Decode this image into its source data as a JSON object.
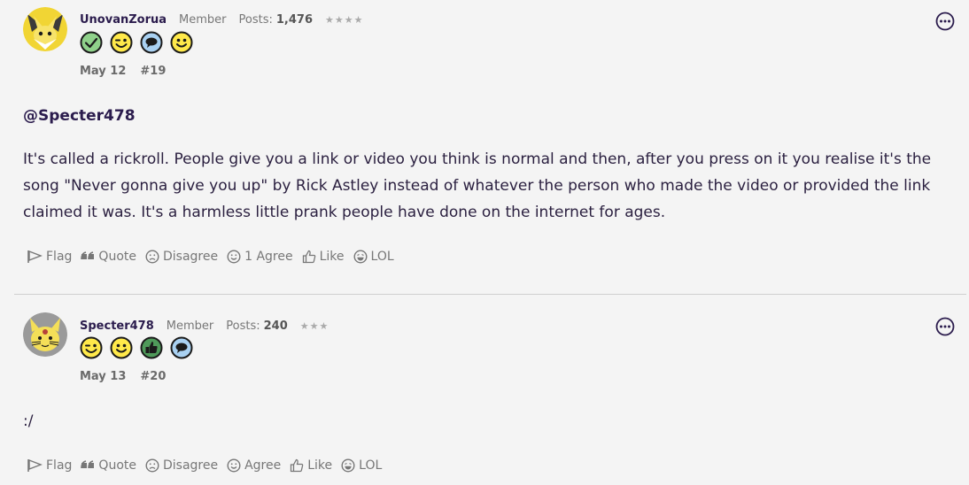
{
  "posts": [
    {
      "username": "UnovanZorua",
      "role": "Member",
      "posts_label": "Posts:",
      "posts_count": "1,476",
      "stars": "★★★★",
      "date": "May 12",
      "number": "#19",
      "badges": [
        "check-badge-icon",
        "wink-badge-icon",
        "speech-badge-icon",
        "smile-badge-icon"
      ],
      "mention": "@Specter478",
      "body_lines": [
        "It's called a rickroll. People give you a link or video you think is normal and then, after you press on it you realise it's the",
        "song \"Never gonna give you up\" by Rick Astley instead of whatever the person who made the video or provided the link",
        "claimed it was. It's a harmless little prank people have done on the internet for ages."
      ],
      "actions": {
        "flag": "Flag",
        "quote": "Quote",
        "disagree": "Disagree",
        "agree": "1 Agree",
        "like": "Like",
        "lol": "LOL"
      }
    },
    {
      "username": "Specter478",
      "role": "Member",
      "posts_label": "Posts:",
      "posts_count": "240",
      "stars": "★★★",
      "date": "May 13",
      "number": "#20",
      "badges": [
        "wink-badge-icon",
        "smile-badge-icon",
        "thumbs-up-badge-icon",
        "speech-badge-icon"
      ],
      "body_lines": [
        ":/"
      ],
      "actions": {
        "flag": "Flag",
        "quote": "Quote",
        "disagree": "Disagree",
        "agree": "Agree",
        "like": "Like",
        "lol": "LOL"
      }
    }
  ],
  "colors": {
    "badge_green": "#8fd18a",
    "badge_yellow": "#ffe94a",
    "badge_blue": "#a9d1f2",
    "badge_darkgreen": "#4f9a5a"
  }
}
